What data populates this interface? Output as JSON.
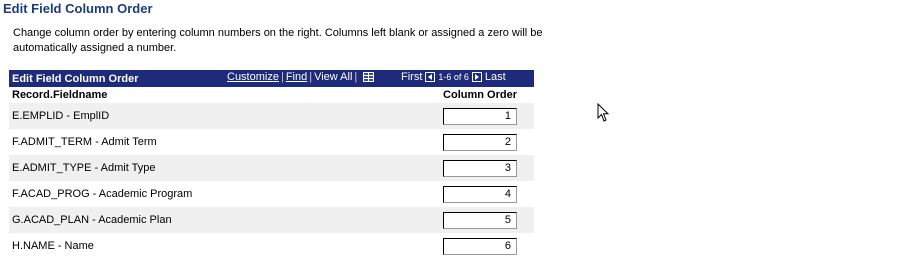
{
  "page": {
    "title": "Edit Field Column Order",
    "instructions": "Change column order by entering column numbers on the right. Columns left blank or assigned a zero will be automatically assigned a number."
  },
  "grid": {
    "title": "Edit Field Column Order",
    "customize_label": "Customize",
    "find_label": "Find",
    "view_all_label": "View All",
    "first_label": "First",
    "range_label": "1-6 of 6",
    "last_label": "Last",
    "col_fieldname": "Record.Fieldname",
    "col_order": "Column Order",
    "rows": [
      {
        "field": "E.EMPLID - EmplID",
        "order": "1"
      },
      {
        "field": "F.ADMIT_TERM - Admit Term",
        "order": "2"
      },
      {
        "field": "E.ADMIT_TYPE - Admit Type",
        "order": "3"
      },
      {
        "field": "F.ACAD_PROG - Academic Program",
        "order": "4"
      },
      {
        "field": "G.ACAD_PLAN - Academic Plan",
        "order": "5"
      },
      {
        "field": "H.NAME - Name",
        "order": "6"
      }
    ]
  },
  "colors": {
    "title": "#1c3c7c",
    "grid_header": "#1e2a7a",
    "row_alt": "#f0f0f0"
  },
  "icons": {
    "grid_icon": "spreadsheet-icon",
    "prev": "triangle-left-icon",
    "next": "triangle-right-icon",
    "cursor": "mouse-pointer-icon"
  }
}
